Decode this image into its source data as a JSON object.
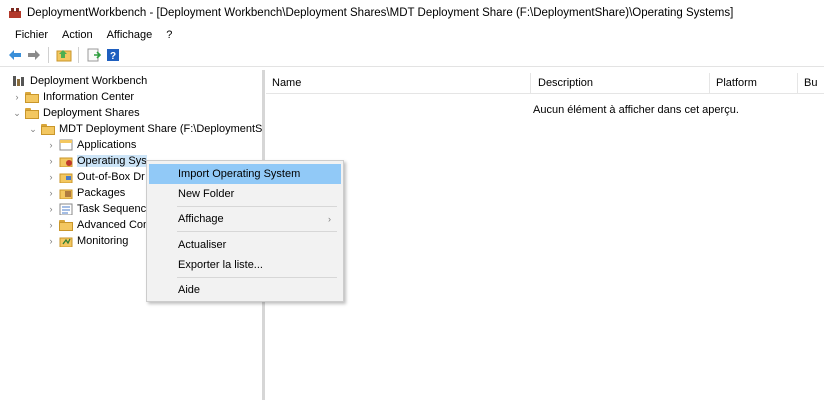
{
  "window": {
    "title": "DeploymentWorkbench - [Deployment Workbench\\Deployment Shares\\MDT Deployment Share (F:\\DeploymentShare)\\Operating Systems]"
  },
  "menu": [
    "Fichier",
    "Action",
    "Affichage",
    "?"
  ],
  "toolbar": {
    "buttons": [
      "back-arrow-icon",
      "forward-arrow-icon",
      "up-folder-icon",
      "export-list-icon",
      "help-icon"
    ],
    "colors": {
      "arrow": "#3a8fd9",
      "help": "#1f5fbf"
    }
  },
  "tree": {
    "root": "Deployment Workbench",
    "information_center": "Information Center",
    "deployment_shares": "Deployment Shares",
    "mdt_share": "MDT Deployment Share (F:\\DeploymentSha",
    "applications": "Applications",
    "operating_systems": "Operating Sys",
    "drivers": "Out-of-Box Dr",
    "packages": "Packages",
    "task_sequences": "Task Sequence",
    "advanced": "Advanced Con",
    "monitoring": "Monitoring"
  },
  "list": {
    "columns": [
      "Name",
      "Description",
      "Platform",
      "Bu"
    ],
    "empty_message": "Aucun élément à afficher dans cet aperçu."
  },
  "context_menu": {
    "import_os": "Import Operating System",
    "new_folder": "New Folder",
    "view": "Affichage",
    "refresh": "Actualiser",
    "export_list": "Exporter la liste...",
    "help": "Aide",
    "highlight_color": "#91c9f7"
  }
}
